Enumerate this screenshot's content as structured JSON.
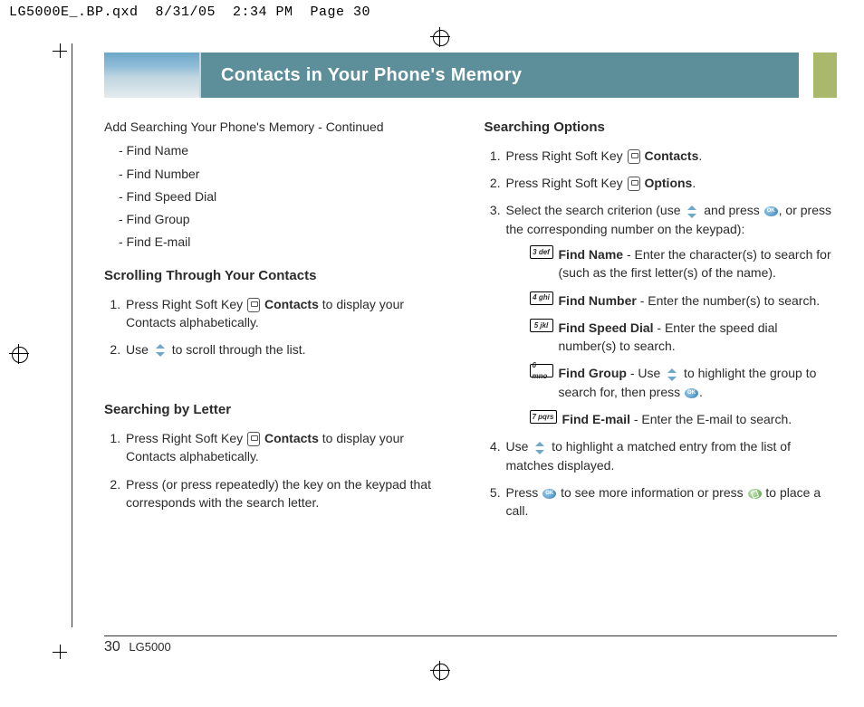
{
  "slug": "LG5000E_.BP.qxd  8/31/05  2:34 PM  Page 30",
  "header": {
    "title": "Contacts in Your Phone's Memory"
  },
  "left": {
    "continued": "Add Searching Your Phone's Memory - Continued",
    "dash": [
      "- Find Name",
      "- Find Number",
      "- Find Speed Dial",
      "- Find Group",
      "- Find E-mail"
    ],
    "scroll_h": "Scrolling Through Your Contacts",
    "scroll_1a": "Press Right Soft Key ",
    "scroll_1b": "Contacts",
    "scroll_1c": " to display your Contacts alphabetically.",
    "scroll_2a": "Use ",
    "scroll_2b": " to scroll through the list.",
    "letter_h": "Searching by Letter",
    "letter_1a": "Press Right Soft Key ",
    "letter_1b": "Contacts",
    "letter_1c": " to display your Contacts alphabetically.",
    "letter_2": "Press (or press repeatedly) the key on the keypad that corresponds with the search letter."
  },
  "right": {
    "opt_h": "Searching Options",
    "s1a": "Press Right Soft Key ",
    "s1b": "Contacts",
    "s1c": ".",
    "s2a": "Press Right Soft Key ",
    "s2b": "Options",
    "s2c": ".",
    "s3a": "Select the search criterion (use ",
    "s3b": " and press ",
    "s3c": ", or press the corresponding number on the keypad):",
    "keys": {
      "k3": "3 def",
      "k4": "4 ghi",
      "k5": "5 jkl",
      "k6": "6 mno",
      "k7": "7 pqrs"
    },
    "i1t": "Find Name",
    "i1d": " - Enter the character(s) to search for (such as the first letter(s) of the name).",
    "i2t": "Find Number",
    "i2d": " - Enter the number(s) to search.",
    "i3t": "Find Speed Dial",
    "i3d": " - Enter the speed dial number(s) to search.",
    "i4t": "Find Group",
    "i4a": " - Use ",
    "i4b": " to highlight the group to search for, then press ",
    "i4c": ".",
    "i5t": "Find E-mail",
    "i5d": " - Enter the E-mail to search.",
    "s4a": "Use ",
    "s4b": " to highlight a matched entry from the list of matches displayed.",
    "s5a": "Press ",
    "s5b": " to see more information or press ",
    "s5c": " to place a call."
  },
  "footer": {
    "page": "30",
    "model": "LG5000"
  }
}
